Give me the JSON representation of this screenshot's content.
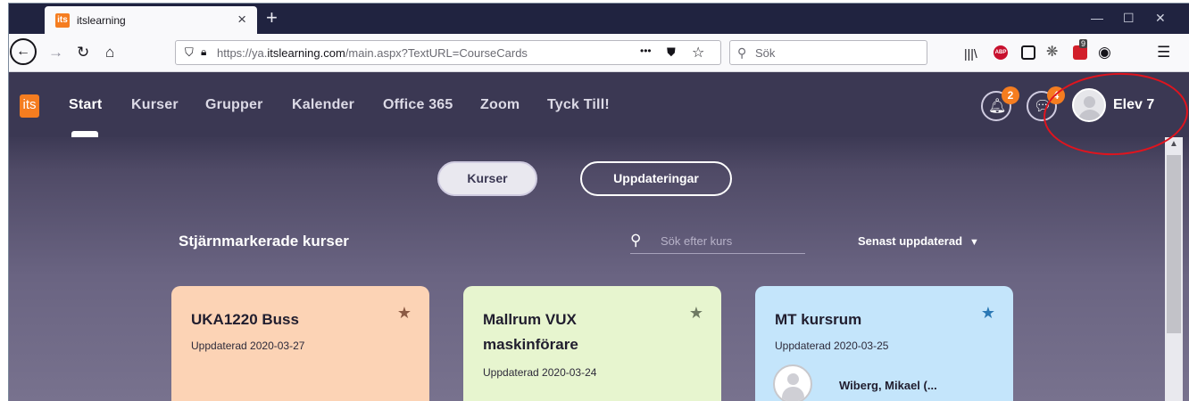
{
  "browser": {
    "tab_title": "itslearning",
    "tab_favicon": "its",
    "tab_close": "×",
    "new_tab": "+",
    "window_controls": {
      "minimize": "—",
      "maximize": "☐",
      "close": "✕"
    },
    "url_prefix": "https://ya.",
    "url_domain": "itslearning.com",
    "url_path": "/main.aspx?TextURL=CourseCards",
    "url_menu": "•••",
    "search_placeholder": "Sök",
    "ext_badge": "9",
    "menu_icon": "☰"
  },
  "app": {
    "logo": "its",
    "nav": [
      "Start",
      "Kurser",
      "Grupper",
      "Kalender",
      "Office 365",
      "Zoom",
      "Tyck Till!"
    ],
    "notifications_count": "2",
    "messages_count": "4",
    "user_name": "Elev 7",
    "toggle": {
      "kurser": "Kurser",
      "updates": "Uppdateringar"
    },
    "section_title": "Stjärnmarkerade kurser",
    "course_search_placeholder": "Sök efter kurs",
    "sort_label": "Senast uppdaterad",
    "sort_arrow": "▼",
    "cards": [
      {
        "title": "UKA1220 Buss",
        "updated": "Uppdaterad 2020-03-27",
        "color": "#fcd3b5",
        "star_color": "#8b5a44"
      },
      {
        "title": "Mallrum VUX maskinförare",
        "updated": "Uppdaterad 2020-03-24",
        "color": "#e7f5cf",
        "star_color": "#6f7a63"
      },
      {
        "title": "MT kursrum",
        "updated": "Uppdaterad 2020-03-25",
        "color": "#c4e5fb",
        "star_color": "#2a78b5",
        "teacher": "Wiberg, Mikael (..."
      }
    ]
  },
  "colors": {
    "accent": "#f57d20",
    "nav_bg": "#3b3853",
    "annotation_circle": "#e0141e"
  }
}
